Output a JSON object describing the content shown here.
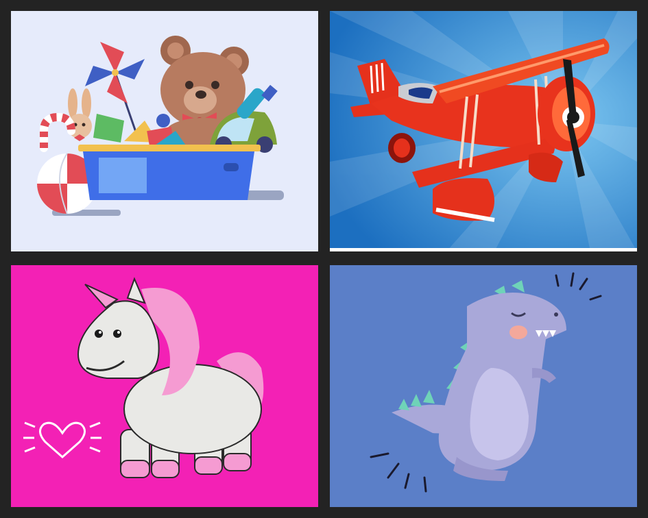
{
  "colors": {
    "frame": "#232323",
    "toybox_bg": "#e6ebfb",
    "plane_sky": "#2f8fd6",
    "unicorn_bg": "#f321b5",
    "dino_bg": "#5b7fc8"
  },
  "tiles": [
    {
      "subject": "toy-box",
      "icons": [
        "teddy-bear-icon",
        "pinwheel-icon",
        "bunny-icon",
        "candy-cane-icon",
        "beach-ball-icon",
        "toy-car-icon",
        "toy-box-icon"
      ]
    },
    {
      "subject": "red-biplane",
      "icons": [
        "biplane-icon",
        "propeller-icon"
      ]
    },
    {
      "subject": "unicorn",
      "icons": [
        "unicorn-icon",
        "heart-icon"
      ]
    },
    {
      "subject": "dinosaur",
      "icons": [
        "dinosaur-icon"
      ]
    }
  ]
}
